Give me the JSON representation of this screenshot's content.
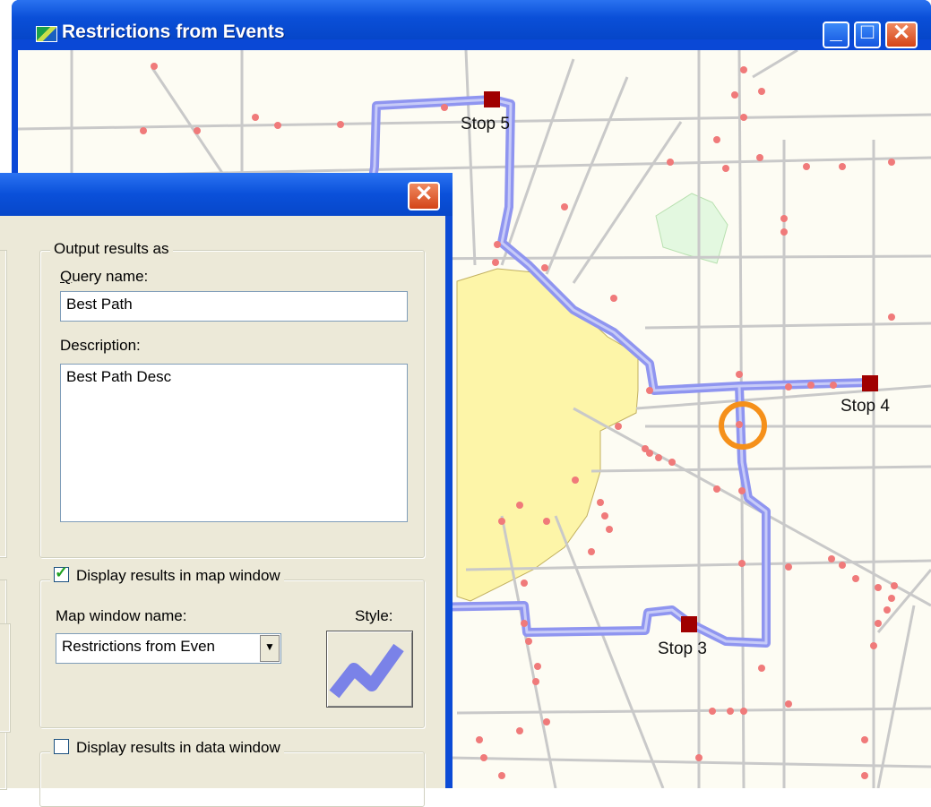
{
  "map_window": {
    "title": "Restrictions from Events",
    "minimize_glyph": "_",
    "maximize_glyph": "□",
    "close_glyph": "✕",
    "stops": [
      {
        "label": "Stop 5"
      },
      {
        "label": "Stop 4"
      },
      {
        "label": "Stop 3"
      }
    ],
    "colors": {
      "route": "#8f95f0",
      "stop": "#a00000",
      "junction": "#f07a7a",
      "road": "#c9c9c9",
      "city": "#fdf5a8",
      "park": "#e3f8e0",
      "highlight": "#f5901a"
    }
  },
  "dialog": {
    "close_glyph": "✕",
    "output_group": {
      "legend": "Output results as",
      "query_label": "Query name:",
      "query_mnemonic": "Q",
      "query_value": "Best Path",
      "description_label": "Description:",
      "description_value": "Best Path Desc"
    },
    "map_group": {
      "checkbox_label": "Display results in map window",
      "checked": true,
      "window_name_label": "Map window name:",
      "window_name_value": "Restrictions from Even",
      "style_label": "Style:"
    },
    "data_group": {
      "checkbox_label": "Display results in data window",
      "checked": false
    }
  }
}
